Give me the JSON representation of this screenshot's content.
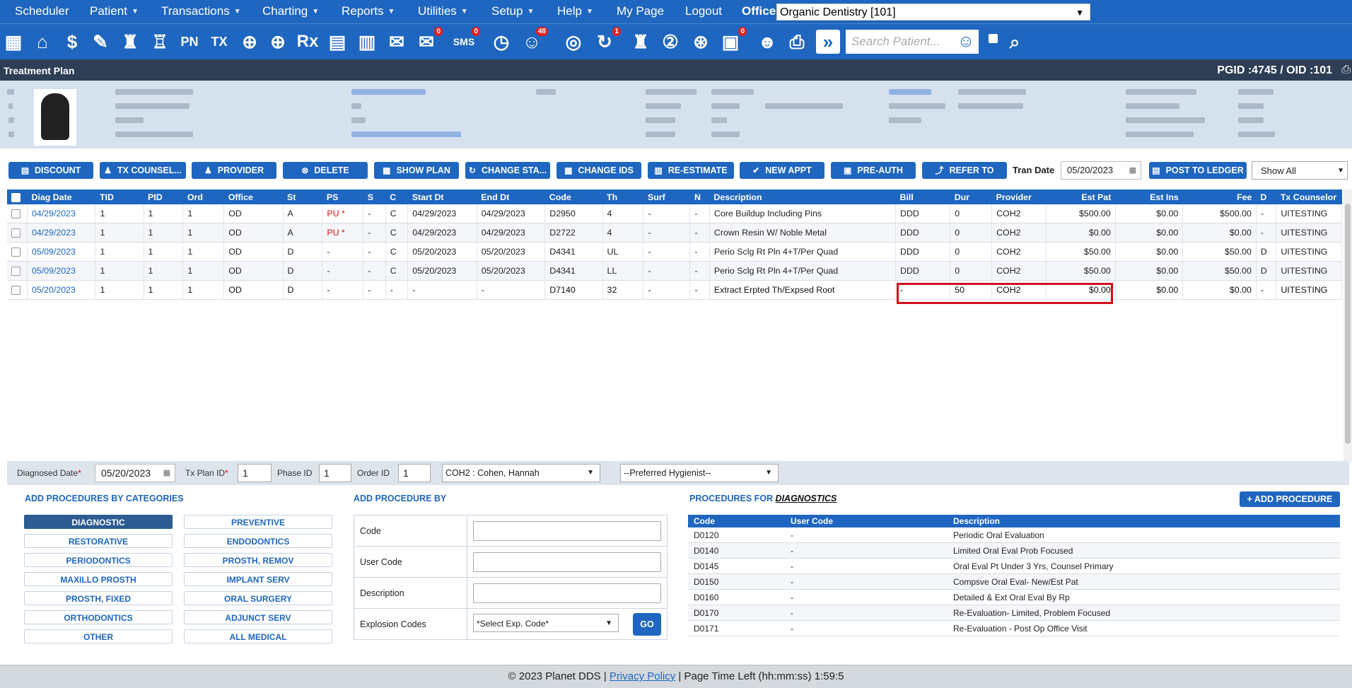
{
  "menu": {
    "items": [
      {
        "label": "Scheduler",
        "caret": false
      },
      {
        "label": "Patient",
        "caret": true
      },
      {
        "label": "Transactions",
        "caret": true
      },
      {
        "label": "Charting",
        "caret": true
      },
      {
        "label": "Reports",
        "caret": true
      },
      {
        "label": "Utilities",
        "caret": true
      },
      {
        "label": "Setup",
        "caret": true
      },
      {
        "label": "Help",
        "caret": true
      },
      {
        "label": "My Page",
        "caret": false
      },
      {
        "label": "Logout",
        "caret": false
      }
    ],
    "office_label": "Office",
    "office_value": "Organic Dentistry [101]"
  },
  "toolbar": {
    "badges": {
      "messages": "0",
      "sms": "0",
      "web": "48",
      "recall": "1",
      "tasks": "0"
    },
    "search_placeholder": "Search Patient...",
    "sms_label": "SMS",
    "pn_label": "PN",
    "tx_label": "TX",
    "rx_label": "Rx"
  },
  "titlebar": {
    "title": "Treatment Plan",
    "ids": "PGID :4745  /  OID :101"
  },
  "actions": {
    "buttons": [
      "DISCOUNT",
      "TX COUNSEL...",
      "PROVIDER",
      "DELETE",
      "SHOW PLAN",
      "CHANGE STA...",
      "CHANGE IDS",
      "RE-ESTIMATE",
      "NEW APPT",
      "PRE-AUTH",
      "REFER TO"
    ],
    "tran_date_label": "Tran Date",
    "tran_date": "05/20/2023",
    "post_to_ledger": "POST TO LEDGER",
    "filter": "Show All"
  },
  "table": {
    "headers": [
      "Diag Date",
      "TID",
      "PID",
      "Ord",
      "Office",
      "St",
      "PS",
      "S",
      "C",
      "Start Dt",
      "End Dt",
      "Code",
      "Th",
      "Surf",
      "N",
      "Description",
      "Bill",
      "Dur",
      "Provider",
      "Est Pat",
      "Est Ins",
      "Fee",
      "D",
      "Tx Counselor"
    ],
    "rows": [
      [
        "04/29/2023",
        "1",
        "1",
        "1",
        "OD",
        "A",
        "PU *",
        "-",
        "C",
        "04/29/2023",
        "04/29/2023",
        "D2950",
        "4",
        "-",
        "-",
        "Core Buildup Including Pins",
        "DDD",
        "0",
        "COH2",
        "$500.00",
        "$0.00",
        "$500.00",
        "-",
        "UITESTING"
      ],
      [
        "04/29/2023",
        "1",
        "1",
        "1",
        "OD",
        "A",
        "PU *",
        "-",
        "C",
        "04/29/2023",
        "04/29/2023",
        "D2722",
        "4",
        "-",
        "-",
        "Crown Resin W/ Noble Metal",
        "DDD",
        "0",
        "COH2",
        "$0.00",
        "$0.00",
        "$0.00",
        "-",
        "UITESTING"
      ],
      [
        "05/09/2023",
        "1",
        "1",
        "1",
        "OD",
        "D",
        "-",
        "-",
        "C",
        "05/20/2023",
        "05/20/2023",
        "D4341",
        "UL",
        "-",
        "-",
        "Perio Sclg Rt Pln 4+T/Per Quad",
        "DDD",
        "0",
        "COH2",
        "$50.00",
        "$0.00",
        "$50.00",
        "D",
        "UITESTING"
      ],
      [
        "05/09/2023",
        "1",
        "1",
        "1",
        "OD",
        "D",
        "-",
        "-",
        "C",
        "05/20/2023",
        "05/20/2023",
        "D4341",
        "LL",
        "-",
        "-",
        "Perio Sclg Rt Pln 4+T/Per Quad",
        "DDD",
        "0",
        "COH2",
        "$50.00",
        "$0.00",
        "$50.00",
        "D",
        "UITESTING"
      ],
      [
        "05/20/2023",
        "1",
        "1",
        "1",
        "OD",
        "D",
        "-",
        "-",
        "-",
        "-",
        "-",
        "D7140",
        "32",
        "-",
        "-",
        "Extract Erpted Th/Expsed Root",
        "-",
        "50",
        "COH2",
        "$0.00",
        "$0.00",
        "$0.00",
        "-",
        "UITESTING"
      ]
    ]
  },
  "dx": {
    "diag_date_label": "Diagnosed Date",
    "diag_date": "05/20/2023",
    "txplan_label": "Tx Plan ID",
    "txplan": "1",
    "phase_label": "Phase ID",
    "phase": "1",
    "order_label": "Order ID",
    "order": "1",
    "provider": "COH2 : Cohen, Hannah",
    "hygienist": "--Preferred Hygienist--"
  },
  "categories": {
    "title": "ADD PROCEDURES BY CATEGORIES",
    "items": [
      "DIAGNOSTIC",
      "PREVENTIVE",
      "RESTORATIVE",
      "ENDODONTICS",
      "PERIODONTICS",
      "PROSTH, REMOV",
      "MAXILLO PROSTH",
      "IMPLANT SERV",
      "PROSTH, FIXED",
      "ORAL SURGERY",
      "ORTHODONTICS",
      "ADJUNCT SERV",
      "OTHER",
      "ALL MEDICAL"
    ]
  },
  "addby": {
    "title": "ADD PROCEDURE BY",
    "code_label": "Code",
    "user_code_label": "User Code",
    "description_label": "Description",
    "explosion_label": "Explosion Codes",
    "explosion_select": "*Select Exp. Code*",
    "go": "GO"
  },
  "procs": {
    "title_prefix": "PROCEDURES FOR ",
    "title_cat": "DIAGNOSTICS",
    "add_button": "+ ADD PROCEDURE",
    "headers": [
      "Code",
      "User Code",
      "Description"
    ],
    "rows": [
      [
        "D0120",
        "-",
        "Periodic Oral Evaluation"
      ],
      [
        "D0140",
        "-",
        "Limited Oral Eval Prob Focused"
      ],
      [
        "D0145",
        "-",
        "Oral Eval Pt Under 3 Yrs, Counsel Primary"
      ],
      [
        "D0150",
        "-",
        "Compsve Oral Eval- New/Est Pat"
      ],
      [
        "D0160",
        "-",
        "Detailed & Ext Oral Eval By Rp"
      ],
      [
        "D0170",
        "-",
        "Re-Evaluation- Limited, Problem Focused"
      ],
      [
        "D0171",
        "-",
        "Re-Evaluation - Post Op Office Visit"
      ]
    ]
  },
  "footer": {
    "copyright": "© 2023 Planet DDS | ",
    "privacy": "Privacy Policy",
    "time_left": " |  Page Time Left (hh:mm:ss) 1:59:5"
  }
}
